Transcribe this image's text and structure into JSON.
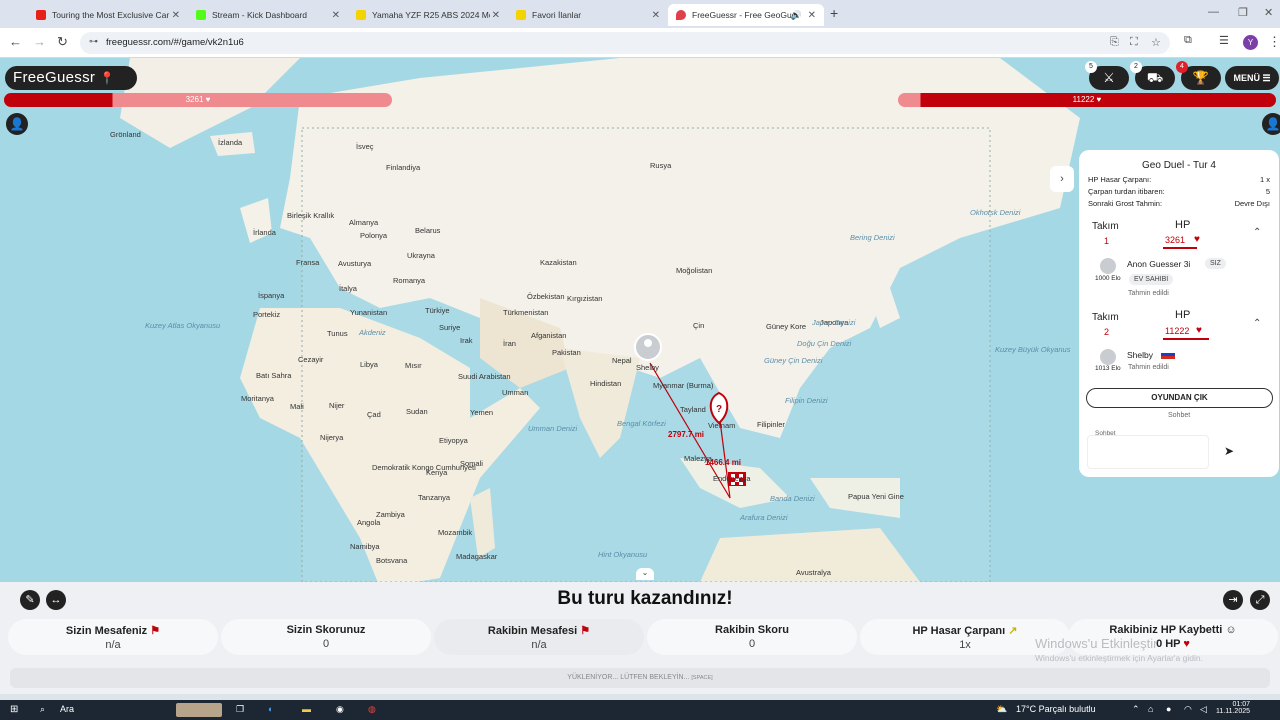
{
  "browser": {
    "tabs": [
      {
        "label": "Touring the Most Exclusive Car",
        "color": "#e62117"
      },
      {
        "label": "Stream - Kick Dashboard",
        "color": "#53fc18"
      },
      {
        "label": "Yamaha YZF R25 ABS 2024 Mo",
        "color": "#f5d300"
      },
      {
        "label": "Favori İlanlar",
        "color": "#f5d300"
      },
      {
        "label": "FreeGuessr - Free GeoGues",
        "color": "#e0404a"
      }
    ],
    "new_tab_label": "+",
    "url": "freeguessr.com/#/game/vk2n1u6",
    "profile_initial": "Y"
  },
  "game": {
    "logo_text": "FreeGuessr",
    "hp_left": "3261",
    "hp_right": "11222",
    "badges": [
      "5",
      "2",
      "4"
    ],
    "menu_label": "MENÜ",
    "map_labels": [
      {
        "text": "Grönland",
        "cls": ""
      },
      {
        "text": "İzlanda",
        "cls": ""
      },
      {
        "text": "İsveç",
        "cls": ""
      },
      {
        "text": "Finlandiya",
        "cls": ""
      },
      {
        "text": "Birleşik Krallık",
        "cls": ""
      },
      {
        "text": "İrlanda",
        "cls": ""
      },
      {
        "text": "Almanya",
        "cls": ""
      },
      {
        "text": "Polonya",
        "cls": ""
      },
      {
        "text": "Belarus",
        "cls": ""
      },
      {
        "text": "Fransa",
        "cls": ""
      },
      {
        "text": "Avusturya",
        "cls": ""
      },
      {
        "text": "Ukrayna",
        "cls": ""
      },
      {
        "text": "İspanya",
        "cls": ""
      },
      {
        "text": "Portekiz",
        "cls": ""
      },
      {
        "text": "İtalya",
        "cls": ""
      },
      {
        "text": "Romanya",
        "cls": ""
      },
      {
        "text": "Yunanistan",
        "cls": ""
      },
      {
        "text": "Türkiye",
        "cls": ""
      },
      {
        "text": "Rusya",
        "cls": ""
      },
      {
        "text": "Kazakistan",
        "cls": ""
      },
      {
        "text": "Moğolistan",
        "cls": ""
      },
      {
        "text": "Özbekistan",
        "cls": ""
      },
      {
        "text": "Kırgızistan",
        "cls": ""
      },
      {
        "text": "Türkmenistan",
        "cls": ""
      },
      {
        "text": "Çin",
        "cls": ""
      },
      {
        "text": "Güney Kore",
        "cls": ""
      },
      {
        "text": "Japonya",
        "cls": ""
      },
      {
        "text": "Tunus",
        "cls": ""
      },
      {
        "text": "Suriye",
        "cls": ""
      },
      {
        "text": "Irak",
        "cls": ""
      },
      {
        "text": "İran",
        "cls": ""
      },
      {
        "text": "Afganistan",
        "cls": ""
      },
      {
        "text": "Pakistan",
        "cls": ""
      },
      {
        "text": "Nepal",
        "cls": ""
      },
      {
        "text": "Cezayir",
        "cls": ""
      },
      {
        "text": "Libya",
        "cls": ""
      },
      {
        "text": "Mısır",
        "cls": ""
      },
      {
        "text": "Suudi Arabistan",
        "cls": ""
      },
      {
        "text": "Umman",
        "cls": ""
      },
      {
        "text": "Hindistan",
        "cls": ""
      },
      {
        "text": "Myanmar (Burma)",
        "cls": ""
      },
      {
        "text": "Tayland",
        "cls": ""
      },
      {
        "text": "Vietnam",
        "cls": ""
      },
      {
        "text": "Filipinler",
        "cls": ""
      },
      {
        "text": "Batı Sahra",
        "cls": ""
      },
      {
        "text": "Moritanya",
        "cls": ""
      },
      {
        "text": "Mali",
        "cls": ""
      },
      {
        "text": "Nijer",
        "cls": ""
      },
      {
        "text": "Çad",
        "cls": ""
      },
      {
        "text": "Sudan",
        "cls": ""
      },
      {
        "text": "Yemen",
        "cls": ""
      },
      {
        "text": "Etiyopya",
        "cls": ""
      },
      {
        "text": "Somali",
        "cls": ""
      },
      {
        "text": "Nijerya",
        "cls": ""
      },
      {
        "text": "Kenya",
        "cls": ""
      },
      {
        "text": "Tanzanya",
        "cls": ""
      },
      {
        "text": "Demokratik Kongo Cumhuriyeti",
        "cls": ""
      },
      {
        "text": "Angola",
        "cls": ""
      },
      {
        "text": "Zambiya",
        "cls": ""
      },
      {
        "text": "Mozambik",
        "cls": ""
      },
      {
        "text": "Namibya",
        "cls": ""
      },
      {
        "text": "Botsvana",
        "cls": ""
      },
      {
        "text": "Madagaskar",
        "cls": ""
      },
      {
        "text": "Malezya",
        "cls": ""
      },
      {
        "text": "Endonezya",
        "cls": ""
      },
      {
        "text": "Papua Yeni Gine",
        "cls": ""
      },
      {
        "text": "Avustralya",
        "cls": ""
      },
      {
        "text": "Kuzey Atlas Okyanusu",
        "cls": "ocean"
      },
      {
        "text": "Akdeniz",
        "cls": "ocean"
      },
      {
        "text": "Umman Denizi",
        "cls": "ocean"
      },
      {
        "text": "Bengal Körfezi",
        "cls": "ocean"
      },
      {
        "text": "Güney Çin Denizi",
        "cls": "ocean"
      },
      {
        "text": "Doğu Çin Denizi",
        "cls": "ocean"
      },
      {
        "text": "Japon Denizi",
        "cls": "ocean"
      },
      {
        "text": "Filipin Denizi",
        "cls": "ocean"
      },
      {
        "text": "Okhotsk Denizi",
        "cls": "ocean"
      },
      {
        "text": "Bering Denizi",
        "cls": "ocean"
      },
      {
        "text": "Kuzey Büyük Okyanus",
        "cls": "ocean"
      },
      {
        "text": "Hint Okyanusu",
        "cls": "ocean"
      },
      {
        "text": "Banda Denizi",
        "cls": "ocean"
      },
      {
        "text": "Arafura Denizi",
        "cls": "ocean"
      },
      {
        "text": "Shelby",
        "cls": ""
      },
      {
        "text": "2797.7 mi",
        "cls": "red"
      },
      {
        "text": "1466.4 mi",
        "cls": "red"
      }
    ]
  },
  "panel": {
    "title": "Geo Duel - Tur 4",
    "rows": [
      {
        "k": "HP Hasar Çarpanı:",
        "v": "1 x"
      },
      {
        "k": "Çarpan turdan itibaren:",
        "v": "5"
      },
      {
        "k": "Sonraki Grost Tahmin:",
        "v": "Devre Dışı"
      }
    ],
    "team_label": "Takım",
    "hp_label": "HP",
    "team1": {
      "num": "1",
      "hp": "3261",
      "player": "Anon Guesser 3i",
      "you": "SIZ",
      "elo": "1000 Elo",
      "host": "EV SAHIBI",
      "status": "Tahmin edildi"
    },
    "team2": {
      "num": "2",
      "hp": "11222",
      "player": "Shelby",
      "elo": "1013 Elo",
      "status": "Tahmin edildi"
    },
    "leave_label": "OYUNDAN ÇIK",
    "chat_tab": "Sohbet",
    "chat_placeholder": "Sohbet"
  },
  "result": {
    "title": "Bu turu kazandınız!",
    "stats": [
      {
        "k": "Sizin Mesafeniz",
        "v": "n/a"
      },
      {
        "k": "Sizin Skorunuz",
        "v": "0"
      },
      {
        "k": "Rakibin Mesafesi",
        "v": "n/a"
      },
      {
        "k": "Rakibin Skoru",
        "v": "0"
      },
      {
        "k": "HP Hasar Çarpanı",
        "v": "1x"
      },
      {
        "k": "Rakibiniz HP Kaybetti",
        "v": "0 HP"
      }
    ],
    "loading": "YÜKLENİYOR... LÜTFEN BEKLEYİN...",
    "loading_hint": "[SPACE]",
    "watermark_title": "Windows'u Etkinleştir",
    "watermark_sub": "Windows'u etkinleştirmek için Ayarlar'a gidin."
  },
  "taskbar": {
    "search": "Ara",
    "weather": "17°C  Parçalı bulutlu",
    "time": "01:07",
    "date": "11.11.2025"
  }
}
